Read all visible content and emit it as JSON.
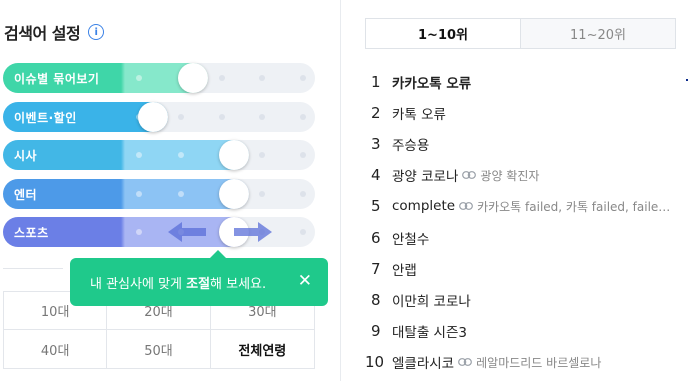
{
  "settings": {
    "title": "검색어 설정",
    "info_icon": "info-icon"
  },
  "sliders": [
    {
      "label": "이슈별 묶어보기",
      "color": "#3fd6a8",
      "color2": "#86e8cb",
      "level": 2
    },
    {
      "label": "이벤트·할인",
      "color": "#3ab3e8",
      "color2": "#3ab3e8",
      "level": 1
    },
    {
      "label": "시사",
      "color": "#42b7e6",
      "color2": "#8fd6f4",
      "level": 3
    },
    {
      "label": "엔터",
      "color": "#4d9ae8",
      "color2": "#8cc3f4",
      "level": 3
    },
    {
      "label": "스포츠",
      "color": "#6b7fe6",
      "color2": "#a9b5f3",
      "level": 3
    }
  ],
  "tooltip": {
    "text_before": "내 관심사에 맞게 ",
    "text_bold": "조절",
    "text_after": "해 보세요.",
    "close": "✕"
  },
  "ages": [
    "10대",
    "20대",
    "30대",
    "40대",
    "50대",
    "전체연령"
  ],
  "ages_active": "전체연령",
  "tabs": [
    {
      "label": "1~10위",
      "active": true
    },
    {
      "label": "11~20위",
      "active": false
    }
  ],
  "ranks": [
    {
      "num": "1",
      "keyword": "카카오톡 오류",
      "bold": true,
      "related": ""
    },
    {
      "num": "2",
      "keyword": "카톡 오류",
      "bold": false,
      "related": ""
    },
    {
      "num": "3",
      "keyword": "주승용",
      "bold": false,
      "related": ""
    },
    {
      "num": "4",
      "keyword": "광양 코로나",
      "bold": false,
      "related": "광양 확진자"
    },
    {
      "num": "5",
      "keyword": "complete",
      "bold": false,
      "related": "카카오톡 failed, 카톡 failed, faile…"
    },
    {
      "num": "6",
      "keyword": "안철수",
      "bold": false,
      "related": ""
    },
    {
      "num": "7",
      "keyword": "안랩",
      "bold": false,
      "related": ""
    },
    {
      "num": "8",
      "keyword": "이만희 코로나",
      "bold": false,
      "related": ""
    },
    {
      "num": "9",
      "keyword": "대탈출 시즌3",
      "bold": false,
      "related": ""
    },
    {
      "num": "10",
      "keyword": "엘클라시코",
      "bold": false,
      "related": "레알마드리드 바르셀로나"
    }
  ],
  "colors": {
    "tooltip": "#1fc98b",
    "info": "#3b82e6"
  }
}
